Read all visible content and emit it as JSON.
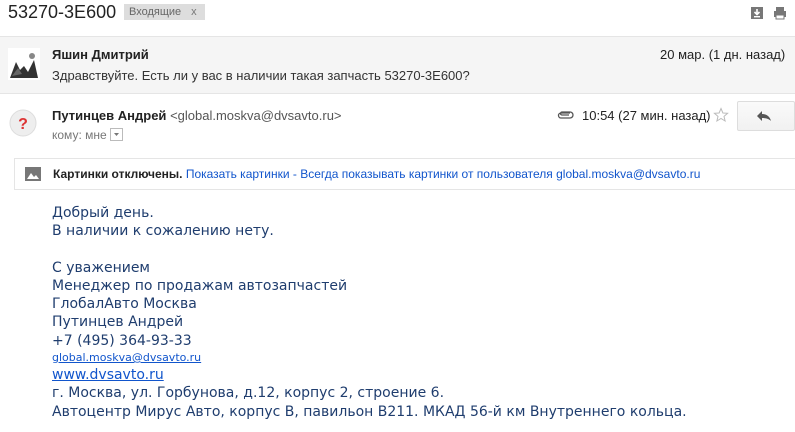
{
  "thread": {
    "subject": "53270-3E600",
    "label": "Входящие",
    "label_remove": "x"
  },
  "toolbar_icons": [
    "download-icon",
    "print-icon"
  ],
  "message1": {
    "sender": "Яшин Дмитрий",
    "date": "20 мар. (1 дн. назад)",
    "snippet": "Здравствуйте. Есть ли у вас в наличии такая запчасть 53270-3E600?"
  },
  "message2": {
    "sender": "Путинцев Андрей",
    "email": "<global.moskva@dvsavto.ru>",
    "to": "кому: мне",
    "time": "10:54 (27 мин. назад)"
  },
  "images_banner": {
    "label": "Картинки отключены.",
    "show": "Показать картинки",
    "sep": " - ",
    "always": "Всегда показывать картинки от пользователя global.moskva@dvsavto.ru"
  },
  "body": {
    "greeting": "Добрый день.",
    "line1": "В наличии к сожалению нету.",
    "regards": "С уважением",
    "position": "Менеджер по продажам автозапчастей",
    "company": "ГлобалАвто Москва",
    "name": "Путинцев Андрей",
    "phone": "+7 (495) 364-93-33",
    "email": "global.moskva@dvsavto.ru",
    "website": "www.dvsavto.ru",
    "address": "г. Москва, ул. Горбунова, д.12, корпус 2, строение 6.",
    "address2": "Автоцентр Мирус Авто, корпус В, павильон В211. МКАД 56-й км Внутреннего кольца."
  }
}
